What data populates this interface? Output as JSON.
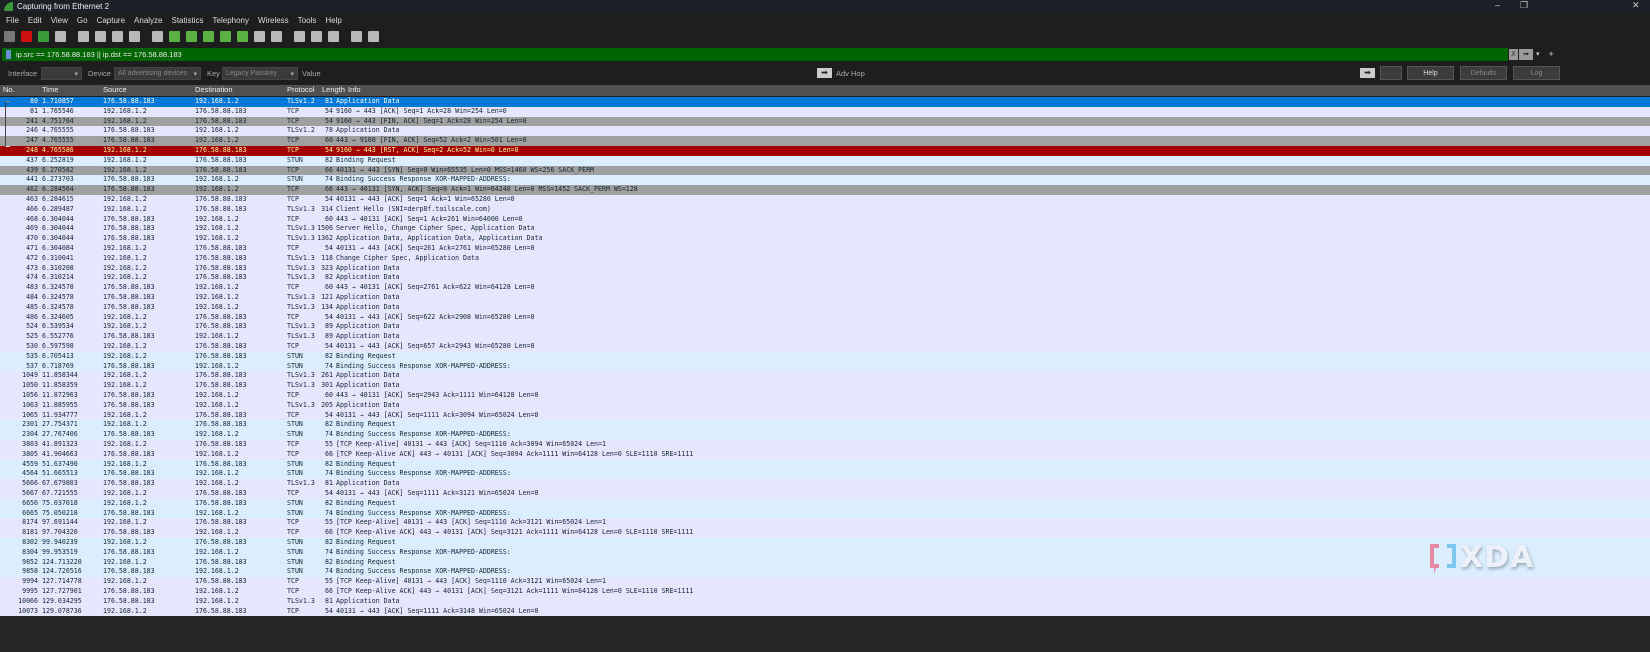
{
  "window": {
    "title": "Capturing from Ethernet 2",
    "minimize": "–",
    "restore": "❐",
    "close": "✕"
  },
  "menu": [
    "File",
    "Edit",
    "View",
    "Go",
    "Capture",
    "Analyze",
    "Statistics",
    "Telephony",
    "Wireless",
    "Tools",
    "Help"
  ],
  "toolbar_icons": [
    "shark-fin-start-icon",
    "stop-icon",
    "restart-icon",
    "options-gear-icon",
    "open-folder-icon",
    "save-icon",
    "close-file-icon",
    "reload-icon",
    "find-icon",
    "back-icon",
    "forward-icon",
    "go-to-packet-icon",
    "first-packet-icon",
    "last-packet-icon",
    "autoscroll-icon",
    "colorize-icon",
    "zoom-in-icon",
    "zoom-out-icon",
    "normal-size-icon",
    "resize-columns-icon",
    "layout-icon"
  ],
  "filter": {
    "value": "ip.src == 176.58.88.183 || ip.dst == 176.58.88.183",
    "clear": "X",
    "apply": "➡",
    "dropdown": "▾",
    "add": "+",
    "bg": "#006400"
  },
  "wireless": {
    "interface_label": "Interface",
    "interface_value": "",
    "device_label": "Device",
    "device_value": "All advertising devices",
    "key_label": "Key",
    "key_value": "Legacy Passkey",
    "value_label": "Value",
    "adv_hop": "Adv Hop",
    "help": "Help",
    "defaults": "Defaults",
    "log": "Log"
  },
  "columns": [
    "No.",
    "Time",
    "Source",
    "Destination",
    "Protocol",
    "Length",
    "Info"
  ],
  "colors": {
    "tcp": "#e7e6ff",
    "stun": "#daeeff",
    "syn_fin": "#a0a0a0",
    "rst": "#a40000",
    "rst_fg": "#fffc9c",
    "selected": "#0078d7",
    "selected_fg": "#ffffff"
  },
  "packets": [
    [
      "80",
      "1.710857",
      "176.58.88.183",
      "192.168.1.2",
      "TLSv1.2",
      "81",
      "Application Data",
      "selected"
    ],
    [
      "81",
      "1.765546",
      "192.168.1.2",
      "176.58.88.183",
      "TCP",
      "54",
      "9160 → 443 [ACK] Seq=1 Ack=28 Win=254 Len=0",
      "tcp"
    ],
    [
      "241",
      "4.751764",
      "192.168.1.2",
      "176.58.88.183",
      "TCP",
      "54",
      "9160 → 443 [FIN, ACK] Seq=1 Ack=28 Win=254 Len=0",
      "syn_fin"
    ],
    [
      "246",
      "4.765555",
      "176.58.88.183",
      "192.168.1.2",
      "TLSv1.2",
      "78",
      "Application Data",
      "tcp"
    ],
    [
      "247",
      "4.765555",
      "176.58.88.183",
      "192.168.1.2",
      "TCP",
      "60",
      "443 → 9160 [FIN, ACK] Seq=52 Ack=2 Win=501 Len=0",
      "syn_fin"
    ],
    [
      "248",
      "4.765586",
      "192.168.1.2",
      "176.58.88.183",
      "TCP",
      "54",
      "9160 → 443 [RST, ACK] Seq=2 Ack=52 Win=0 Len=0",
      "rst"
    ],
    [
      "437",
      "6.252819",
      "192.168.1.2",
      "176.58.88.183",
      "STUN",
      "82",
      "Binding Request",
      "stun"
    ],
    [
      "439",
      "6.270582",
      "192.168.1.2",
      "176.58.88.183",
      "TCP",
      "66",
      "40131 → 443 [SYN] Seq=0 Win=65535 Len=0 MSS=1460 WS=256 SACK_PERM",
      "syn_fin"
    ],
    [
      "441",
      "6.273703",
      "176.58.88.183",
      "192.168.1.2",
      "STUN",
      "74",
      "Binding Success Response XOR-MAPPED-ADDRESS:",
      "stun"
    ],
    [
      "462",
      "6.284564",
      "176.58.88.183",
      "192.168.1.2",
      "TCP",
      "66",
      "443 → 40131 [SYN, ACK] Seq=0 Ack=1 Win=64240 Len=0 MSS=1452 SACK_PERM WS=128",
      "syn_fin"
    ],
    [
      "463",
      "6.284615",
      "192.168.1.2",
      "176.58.88.183",
      "TCP",
      "54",
      "40131 → 443 [ACK] Seq=1 Ack=1 Win=65280 Len=0",
      "tcp"
    ],
    [
      "466",
      "6.289487",
      "192.168.1.2",
      "176.58.88.183",
      "TLSv1.3",
      "314",
      "Client Hello (SNI=derp8f.tailscale.com)",
      "tcp"
    ],
    [
      "468",
      "6.304044",
      "176.58.88.183",
      "192.168.1.2",
      "TCP",
      "60",
      "443 → 40131 [ACK] Seq=1 Ack=261 Win=64000 Len=0",
      "tcp"
    ],
    [
      "469",
      "6.304044",
      "176.58.88.183",
      "192.168.1.2",
      "TLSv1.3",
      "1506",
      "Server Hello, Change Cipher Spec, Application Data",
      "tcp"
    ],
    [
      "470",
      "6.304044",
      "176.58.88.183",
      "192.168.1.2",
      "TLSv1.3",
      "1362",
      "Application Data, Application Data, Application Data",
      "tcp"
    ],
    [
      "471",
      "6.304084",
      "192.168.1.2",
      "176.58.88.183",
      "TCP",
      "54",
      "40131 → 443 [ACK] Seq=261 Ack=2761 Win=65280 Len=0",
      "tcp"
    ],
    [
      "472",
      "6.310041",
      "192.168.1.2",
      "176.58.88.183",
      "TLSv1.3",
      "118",
      "Change Cipher Spec, Application Data",
      "tcp"
    ],
    [
      "473",
      "6.310208",
      "192.168.1.2",
      "176.58.88.183",
      "TLSv1.3",
      "323",
      "Application Data",
      "tcp"
    ],
    [
      "474",
      "6.310214",
      "192.168.1.2",
      "176.58.88.183",
      "TLSv1.3",
      "82",
      "Application Data",
      "tcp"
    ],
    [
      "483",
      "6.324578",
      "176.58.88.183",
      "192.168.1.2",
      "TCP",
      "60",
      "443 → 40131 [ACK] Seq=2761 Ack=622 Win=64128 Len=0",
      "tcp"
    ],
    [
      "484",
      "6.324578",
      "176.58.88.183",
      "192.168.1.2",
      "TLSv1.3",
      "121",
      "Application Data",
      "tcp"
    ],
    [
      "485",
      "6.324578",
      "176.58.88.183",
      "192.168.1.2",
      "TLSv1.3",
      "134",
      "Application Data",
      "tcp"
    ],
    [
      "486",
      "6.324605",
      "192.168.1.2",
      "176.58.88.183",
      "TCP",
      "54",
      "40131 → 443 [ACK] Seq=622 Ack=2908 Win=65280 Len=0",
      "tcp"
    ],
    [
      "524",
      "6.539534",
      "192.168.1.2",
      "176.58.88.183",
      "TLSv1.3",
      "89",
      "Application Data",
      "tcp"
    ],
    [
      "525",
      "6.552776",
      "176.58.88.183",
      "192.168.1.2",
      "TLSv1.3",
      "89",
      "Application Data",
      "tcp"
    ],
    [
      "530",
      "6.597598",
      "192.168.1.2",
      "176.58.88.183",
      "TCP",
      "54",
      "40131 → 443 [ACK] Seq=657 Ack=2943 Win=65280 Len=0",
      "tcp"
    ],
    [
      "535",
      "6.705413",
      "192.168.1.2",
      "176.58.88.183",
      "STUN",
      "82",
      "Binding Request",
      "stun"
    ],
    [
      "537",
      "6.718769",
      "176.58.88.183",
      "192.168.1.2",
      "STUN",
      "74",
      "Binding Success Response XOR-MAPPED-ADDRESS:",
      "stun"
    ],
    [
      "1049",
      "11.858344",
      "192.168.1.2",
      "176.58.88.183",
      "TLSv1.3",
      "261",
      "Application Data",
      "tcp"
    ],
    [
      "1050",
      "11.858359",
      "192.168.1.2",
      "176.58.88.183",
      "TLSv1.3",
      "301",
      "Application Data",
      "tcp"
    ],
    [
      "1056",
      "11.872963",
      "176.58.88.183",
      "192.168.1.2",
      "TCP",
      "60",
      "443 → 40131 [ACK] Seq=2943 Ack=1111 Win=64128 Len=0",
      "tcp"
    ],
    [
      "1063",
      "11.885955",
      "176.58.88.183",
      "192.168.1.2",
      "TLSv1.3",
      "205",
      "Application Data",
      "tcp"
    ],
    [
      "1065",
      "11.934777",
      "192.168.1.2",
      "176.58.88.183",
      "TCP",
      "54",
      "40131 → 443 [ACK] Seq=1111 Ack=3094 Win=65024 Len=0",
      "tcp"
    ],
    [
      "2301",
      "27.754371",
      "192.168.1.2",
      "176.58.88.183",
      "STUN",
      "82",
      "Binding Request",
      "stun"
    ],
    [
      "2304",
      "27.767406",
      "176.58.88.183",
      "192.168.1.2",
      "STUN",
      "74",
      "Binding Success Response XOR-MAPPED-ADDRESS:",
      "stun"
    ],
    [
      "3803",
      "41.891323",
      "192.168.1.2",
      "176.58.88.183",
      "TCP",
      "55",
      "[TCP Keep-Alive] 40131 → 443 [ACK] Seq=1110 Ack=3094 Win=65024 Len=1",
      "tcp"
    ],
    [
      "3805",
      "41.904663",
      "176.58.88.183",
      "192.168.1.2",
      "TCP",
      "66",
      "[TCP Keep-Alive ACK] 443 → 40131 [ACK] Seq=3094 Ack=1111 Win=64128 Len=0 SLE=1110 SRE=1111",
      "tcp"
    ],
    [
      "4559",
      "51.637490",
      "192.168.1.2",
      "176.58.88.183",
      "STUN",
      "82",
      "Binding Request",
      "stun"
    ],
    [
      "4564",
      "51.665513",
      "176.58.88.183",
      "192.168.1.2",
      "STUN",
      "74",
      "Binding Success Response XOR-MAPPED-ADDRESS:",
      "stun"
    ],
    [
      "5666",
      "67.679803",
      "176.58.88.183",
      "192.168.1.2",
      "TLSv1.3",
      "81",
      "Application Data",
      "tcp"
    ],
    [
      "5667",
      "67.721555",
      "192.168.1.2",
      "176.58.88.183",
      "TCP",
      "54",
      "40131 → 443 [ACK] Seq=1111 Ack=3121 Win=65024 Len=0",
      "tcp"
    ],
    [
      "6656",
      "75.037018",
      "192.168.1.2",
      "176.58.88.183",
      "STUN",
      "82",
      "Binding Request",
      "stun"
    ],
    [
      "6665",
      "75.050218",
      "176.58.88.183",
      "192.168.1.2",
      "STUN",
      "74",
      "Binding Success Response XOR-MAPPED-ADDRESS:",
      "stun"
    ],
    [
      "8174",
      "97.691144",
      "192.168.1.2",
      "176.58.88.183",
      "TCP",
      "55",
      "[TCP Keep-Alive] 40131 → 443 [ACK] Seq=1110 Ack=3121 Win=65024 Len=1",
      "tcp"
    ],
    [
      "8181",
      "97.704320",
      "176.58.88.183",
      "192.168.1.2",
      "TCP",
      "66",
      "[TCP Keep-Alive ACK] 443 → 40131 [ACK] Seq=3121 Ack=1111 Win=64128 Len=0 SLE=1110 SRE=1111",
      "tcp"
    ],
    [
      "8302",
      "99.940239",
      "192.168.1.2",
      "176.58.88.183",
      "STUN",
      "82",
      "Binding Request",
      "stun"
    ],
    [
      "8304",
      "99.953519",
      "176.58.88.183",
      "192.168.1.2",
      "STUN",
      "74",
      "Binding Success Response XOR-MAPPED-ADDRESS:",
      "stun"
    ],
    [
      "9852",
      "124.713220",
      "192.168.1.2",
      "176.58.88.183",
      "STUN",
      "82",
      "Binding Request",
      "stun"
    ],
    [
      "9858",
      "124.726516",
      "176.58.88.183",
      "192.168.1.2",
      "STUN",
      "74",
      "Binding Success Response XOR-MAPPED-ADDRESS:",
      "stun"
    ],
    [
      "9994",
      "127.714778",
      "192.168.1.2",
      "176.58.88.183",
      "TCP",
      "55",
      "[TCP Keep-Alive] 40131 → 443 [ACK] Seq=1110 Ack=3121 Win=65024 Len=1",
      "tcp"
    ],
    [
      "9995",
      "127.727901",
      "176.58.88.183",
      "192.168.1.2",
      "TCP",
      "66",
      "[TCP Keep-Alive ACK] 443 → 40131 [ACK] Seq=3121 Ack=1111 Win=64128 Len=0 SLE=1110 SRE=1111",
      "tcp"
    ],
    [
      "10066",
      "129.034295",
      "176.58.88.183",
      "192.168.1.2",
      "TLSv1.3",
      "81",
      "Application Data",
      "tcp"
    ],
    [
      "10073",
      "129.078736",
      "192.168.1.2",
      "176.58.88.183",
      "TCP",
      "54",
      "40131 → 443 [ACK] Seq=1111 Ack=3148 Win=65024 Len=0",
      "tcp"
    ]
  ],
  "watermark": "XDA"
}
